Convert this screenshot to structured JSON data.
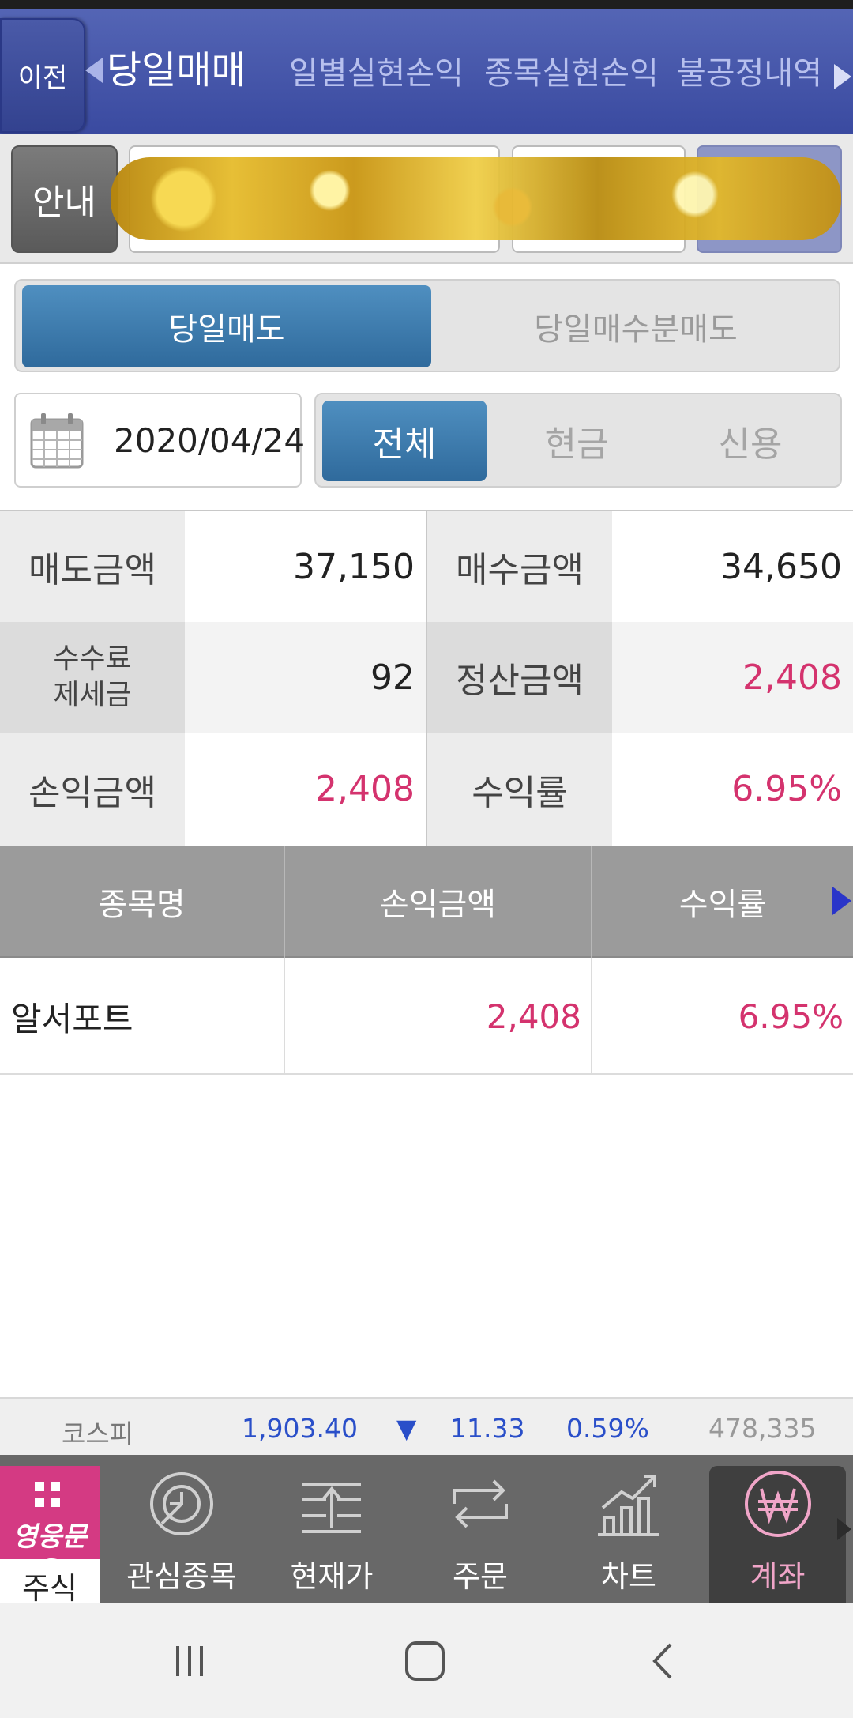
{
  "header": {
    "back_label": "이전",
    "tabs": [
      "당일매매",
      "일별실현손익",
      "종목실현손익",
      "불공정내역"
    ]
  },
  "account": {
    "guide_label": "안내"
  },
  "sell_type": {
    "options": [
      "당일매도",
      "당일매수분매도"
    ]
  },
  "filter": {
    "date": "2020/04/24",
    "options": [
      "전체",
      "현금",
      "신용"
    ]
  },
  "summary": {
    "sell_amount_label": "매도금액",
    "sell_amount": "37,150",
    "buy_amount_label": "매수금액",
    "buy_amount": "34,650",
    "fee_label_1": "수수료",
    "fee_label_2": "제세금",
    "fee": "92",
    "settle_label": "정산금액",
    "settle_amount": "2,408",
    "pnl_label": "손익금액",
    "pnl_amount": "2,408",
    "return_label": "수익률",
    "return_rate": "6.95%"
  },
  "table": {
    "headers": [
      "종목명",
      "손익금액",
      "수익률"
    ],
    "rows": [
      {
        "name": "알서포트",
        "pnl": "2,408",
        "rate": "6.95%"
      }
    ]
  },
  "ticker": {
    "name": "코스피",
    "value": "1,903.40",
    "arrow": "▼",
    "change": "11.33",
    "pct": "0.59%",
    "volume": "478,335"
  },
  "bottom_nav": {
    "brand_text": "영웅문S",
    "brand_label": "주식",
    "items": [
      "관심종목",
      "현재가",
      "주문",
      "차트",
      "계좌"
    ]
  },
  "colors": {
    "header_blue": "#3a4aa0",
    "button_blue": "#2f6a9c",
    "positive_red": "#d4336e",
    "ticker_blue": "#2a4fc9",
    "brand_pink": "#d43a83"
  }
}
